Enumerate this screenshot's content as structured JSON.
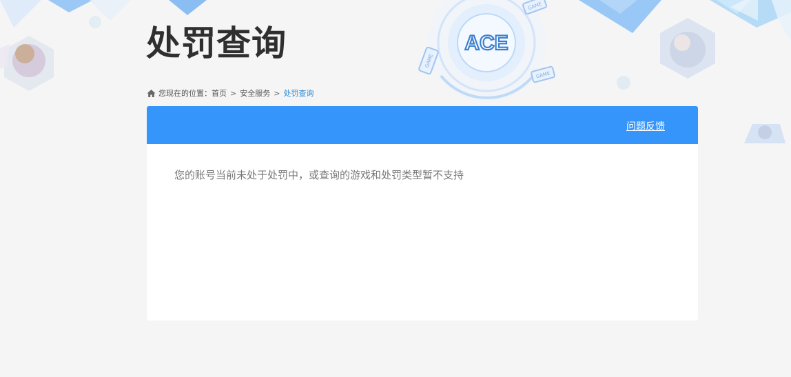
{
  "page": {
    "title": "处罚查询"
  },
  "logo": {
    "text": "ACE"
  },
  "decor": {
    "badge_text": "GAME"
  },
  "breadcrumb": {
    "prefix": "您现在的位置：",
    "items": [
      "首页",
      "安全服务",
      "处罚查询"
    ],
    "separator": ">"
  },
  "panel": {
    "feedback_label": "问题反馈",
    "message": "您的账号当前未处于处罚中，或查询的游戏和处罚类型暂不支持"
  },
  "colors": {
    "header_blue": "#3595fb",
    "breadcrumb_current": "#2a8ad8",
    "page_background": "#f5f5f5"
  },
  "icons": [
    "home-icon",
    "ace-logo"
  ]
}
